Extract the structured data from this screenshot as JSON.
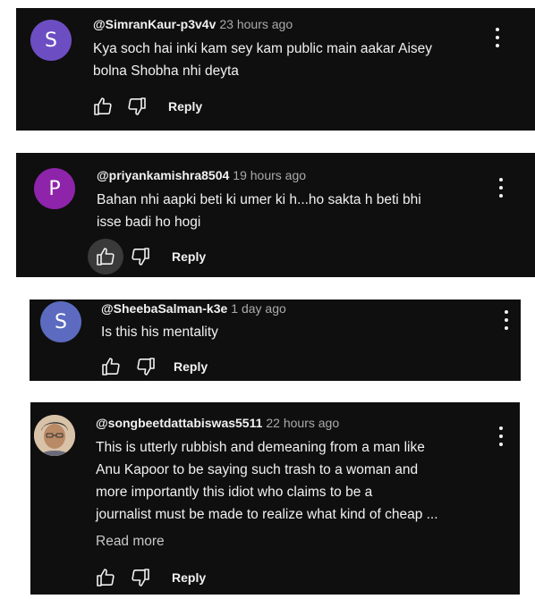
{
  "comments": [
    {
      "avatar_letter": "S",
      "avatar_color": "#6c4ec2",
      "handle": "@SimranKaur-p3v4v",
      "time": "23 hours ago",
      "lines": [
        "Kya soch hai inki kam sey kam public main aakar Aisey",
        "bolna Shobha nhi deyta"
      ],
      "reply_label": "Reply"
    },
    {
      "avatar_letter": "P",
      "avatar_color": "#8e24aa",
      "handle": "@priyankamishra8504",
      "time": "19 hours ago",
      "lines": [
        "Bahan nhi aapki beti ki umer ki h...ho sakta h beti bhi",
        "isse badi ho hogi"
      ],
      "reply_label": "Reply"
    },
    {
      "avatar_letter": "S",
      "avatar_color": "#5c6bc0",
      "handle": "@SheebaSalman-k3e",
      "time": "1 day ago",
      "lines": [
        "Is this his mentality"
      ],
      "reply_label": "Reply"
    },
    {
      "avatar_letter": "",
      "avatar_color": "#c9a889",
      "handle": "@songbeetdattabiswas5511",
      "time": "22 hours ago",
      "lines": [
        "This is utterly rubbish and demeaning from a man like",
        "Anu Kapoor to be saying such trash to a woman and",
        "more importantly this idiot who claims to be a",
        "journalist must be made to realize what kind of cheap ..."
      ],
      "read_more": "Read more",
      "reply_label": "Reply"
    }
  ],
  "icons": {
    "like": "thumbs-up-icon",
    "dislike": "thumbs-down-icon",
    "more": "more-vertical-icon"
  }
}
